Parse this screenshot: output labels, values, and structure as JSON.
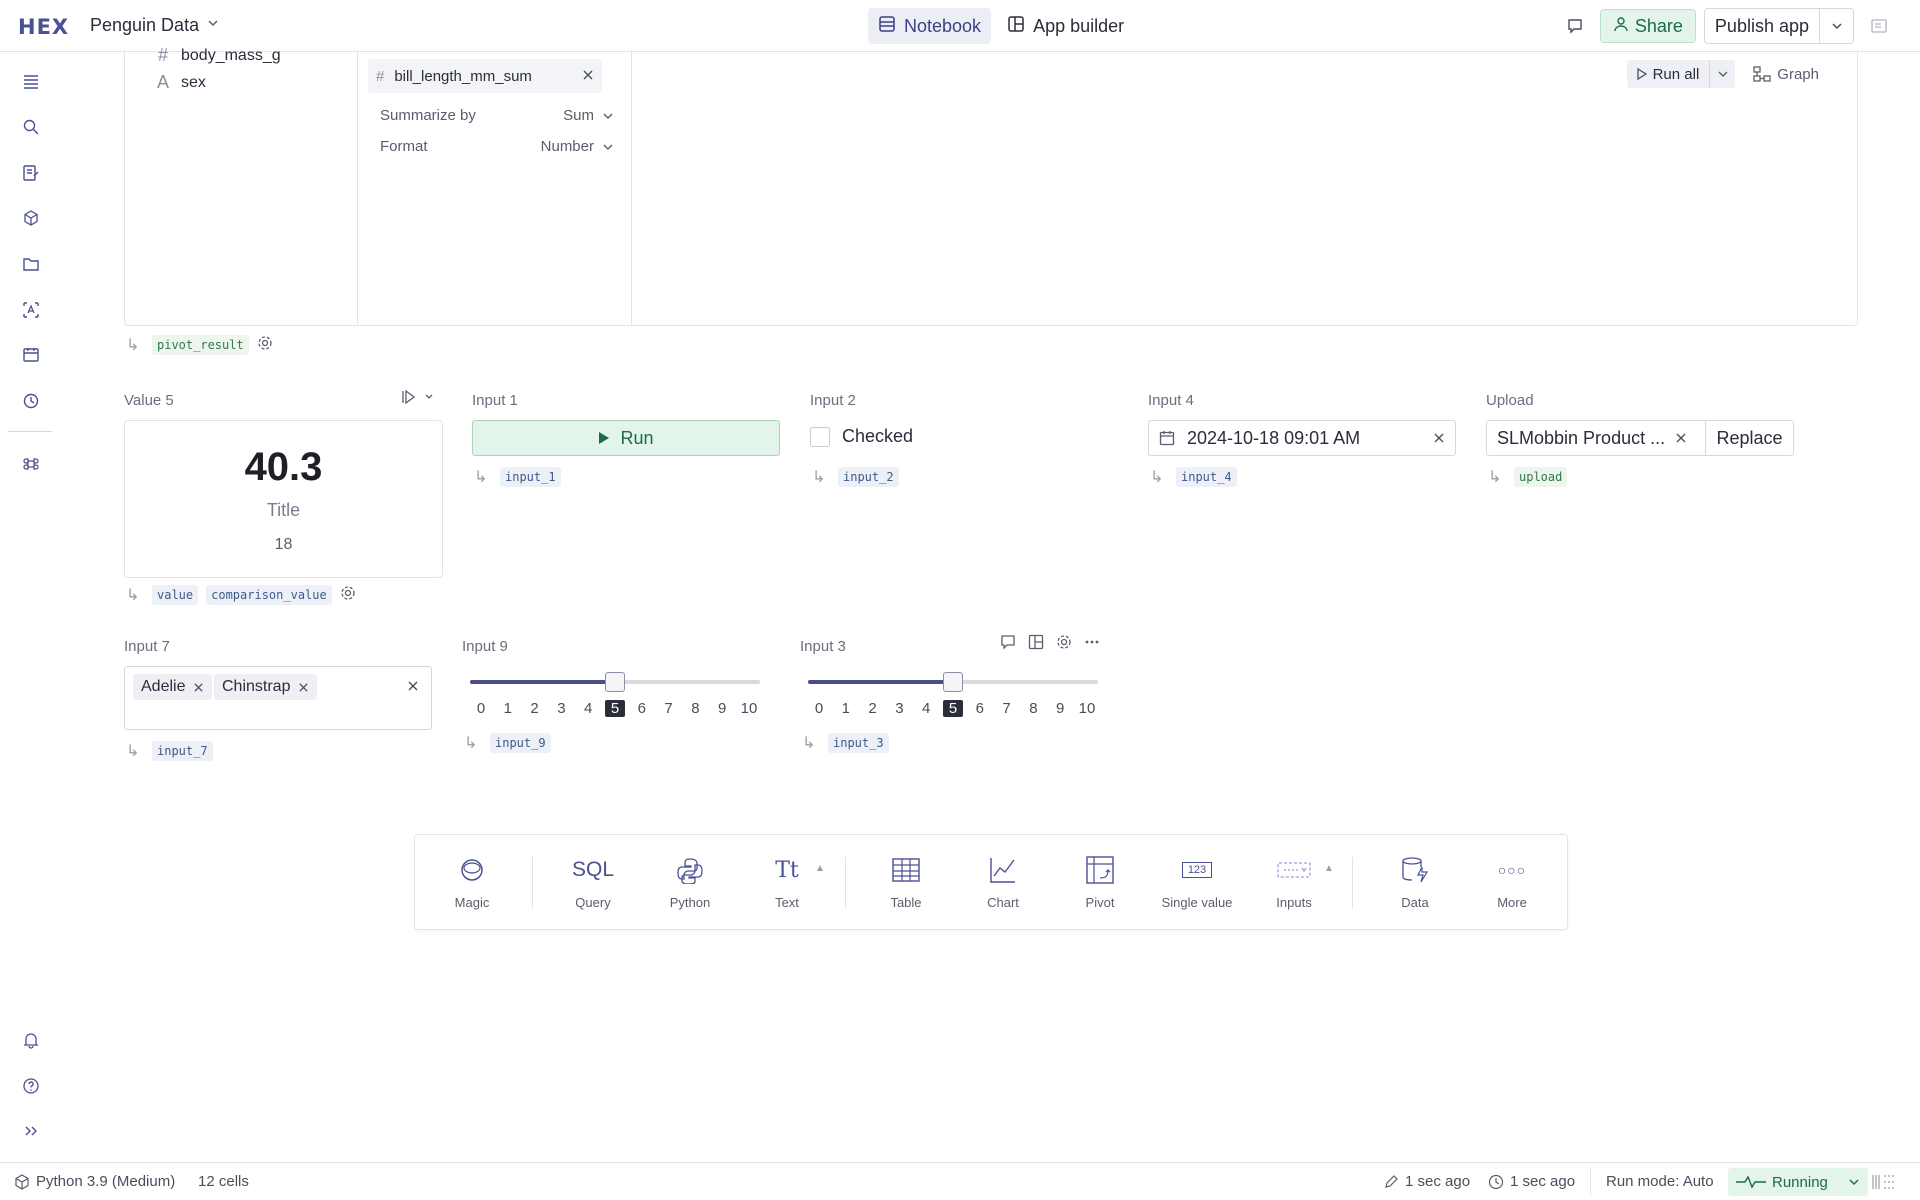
{
  "app": {
    "logo_text": "HEX",
    "project_title": "Penguin Data"
  },
  "header": {
    "tabs": [
      {
        "label": "Notebook",
        "active": true
      },
      {
        "label": "App builder",
        "active": false
      }
    ],
    "share_label": "Share",
    "publish_label": "Publish app"
  },
  "rail": {
    "icons": [
      "outline-icon",
      "search-icon",
      "variables-icon",
      "components-icon",
      "files-icon",
      "data-sources-icon",
      "schedule-icon",
      "history-icon",
      "command-icon",
      "bell-icon",
      "help-icon",
      "expand-icon"
    ]
  },
  "pivot": {
    "fields": [
      {
        "type": "#",
        "name": "body_mass_g"
      },
      {
        "type": "A",
        "name": "sex"
      }
    ],
    "value_field": {
      "type": "#",
      "name": "bill_length_mm_sum"
    },
    "props": [
      {
        "label": "Summarize by",
        "value": "Sum"
      },
      {
        "label": "Format",
        "value": "Number"
      }
    ],
    "run_all_label": "Run all",
    "graph_label": "Graph",
    "output_var": "pivot_result"
  },
  "value5": {
    "label": "Value 5",
    "value": "40.3",
    "title": "Title",
    "comparison": "18",
    "vars": [
      "value",
      "comparison_value"
    ]
  },
  "input1": {
    "label": "Input 1",
    "button": "Run",
    "var": "input_1"
  },
  "input2": {
    "label": "Input 2",
    "checkbox_label": "Checked",
    "var": "input_2"
  },
  "input4": {
    "label": "Input 4",
    "value": "2024-10-18 09:01 AM",
    "var": "input_4"
  },
  "upload": {
    "label": "Upload",
    "filename": "SLMobbin Product ...",
    "replace_label": "Replace",
    "var": "upload"
  },
  "input7": {
    "label": "Input 7",
    "tags": [
      "Adelie",
      "Chinstrap"
    ],
    "var": "input_7"
  },
  "input9": {
    "label": "Input 9",
    "min": 0,
    "max": 10,
    "value": 5,
    "ticks": [
      "0",
      "1",
      "2",
      "3",
      "4",
      "5",
      "6",
      "7",
      "8",
      "9",
      "10"
    ],
    "var": "input_9"
  },
  "input3": {
    "label": "Input 3",
    "min": 0,
    "max": 10,
    "value": 5,
    "ticks": [
      "0",
      "1",
      "2",
      "3",
      "4",
      "5",
      "6",
      "7",
      "8",
      "9",
      "10"
    ],
    "var": "input_3"
  },
  "add_bar": {
    "items": [
      {
        "label": "Magic",
        "icon": "magic-icon"
      },
      {
        "label": "Query",
        "icon": "sql-icon",
        "glyph": "SQL"
      },
      {
        "label": "Python",
        "icon": "python-icon"
      },
      {
        "label": "Text",
        "icon": "text-icon",
        "glyph": "Tt"
      },
      {
        "label": "Table",
        "icon": "table-icon"
      },
      {
        "label": "Chart",
        "icon": "chart-icon"
      },
      {
        "label": "Pivot",
        "icon": "pivot-icon"
      },
      {
        "label": "Single value",
        "icon": "single-value-icon",
        "glyph": "123"
      },
      {
        "label": "Inputs",
        "icon": "inputs-icon"
      },
      {
        "label": "Data",
        "icon": "data-icon"
      },
      {
        "label": "More",
        "icon": "more-icon",
        "glyph": "○○○"
      }
    ]
  },
  "status": {
    "kernel": "Python 3.9 (Medium)",
    "cells": "12 cells",
    "edited": "1 sec ago",
    "saved": "1 sec ago",
    "run_mode": "Run mode: Auto",
    "state": "Running"
  },
  "colors": {
    "brand": "#4a5193",
    "success_bg": "#e3f4ea",
    "success_text": "#1e6b45"
  }
}
